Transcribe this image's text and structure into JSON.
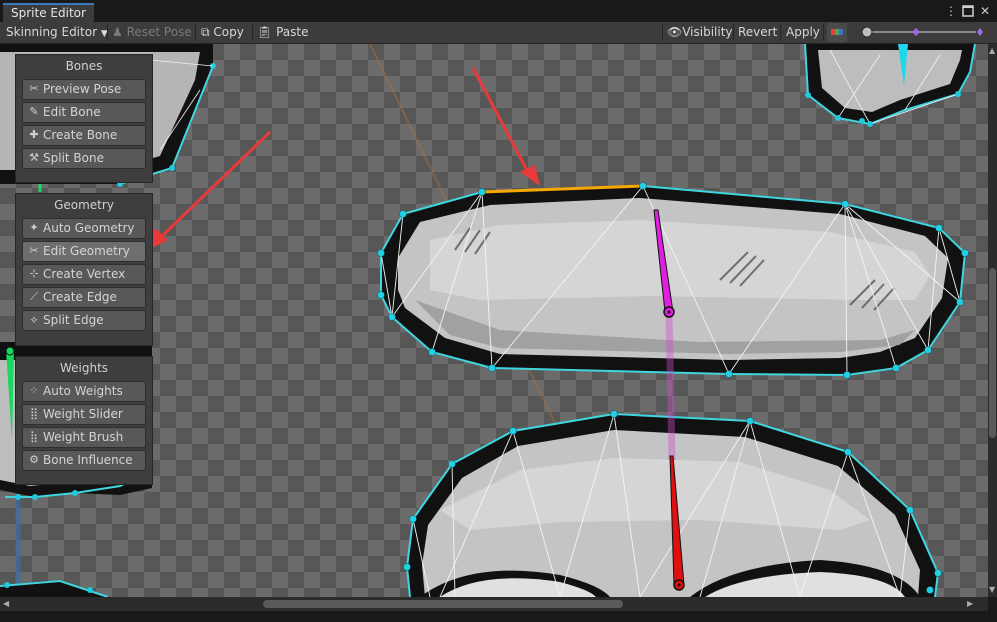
{
  "window": {
    "tab_title": "Sprite Editor",
    "menu_icon": "kebab-icon",
    "maximize_icon": "maximize-icon",
    "close_icon": "close-icon"
  },
  "toolbar": {
    "mode_dropdown": "Skinning Editor",
    "reset_pose": "Reset Pose",
    "copy": "Copy",
    "paste": "Paste",
    "visibility": "Visibility",
    "revert": "Revert",
    "apply": "Apply",
    "colors": {
      "accent": "#3a79bb",
      "toolbar_bg": "#3c3c3c"
    }
  },
  "panels": {
    "bones": {
      "title": "Bones",
      "buttons": [
        {
          "label": "Preview Pose",
          "icon": "preview-pose-icon"
        },
        {
          "label": "Edit Bone",
          "icon": "edit-bone-icon"
        },
        {
          "label": "Create Bone",
          "icon": "create-bone-icon"
        },
        {
          "label": "Split Bone",
          "icon": "split-bone-icon"
        }
      ]
    },
    "geometry": {
      "title": "Geometry",
      "buttons": [
        {
          "label": "Auto Geometry",
          "icon": "auto-geometry-icon"
        },
        {
          "label": "Edit Geometry",
          "icon": "edit-geometry-icon",
          "active": true
        },
        {
          "label": "Create Vertex",
          "icon": "create-vertex-icon"
        },
        {
          "label": "Create Edge",
          "icon": "create-edge-icon"
        },
        {
          "label": "Split Edge",
          "icon": "split-edge-icon"
        }
      ]
    },
    "weights": {
      "title": "Weights",
      "buttons": [
        {
          "label": "Auto Weights",
          "icon": "auto-weights-icon"
        },
        {
          "label": "Weight Slider",
          "icon": "weight-slider-icon"
        },
        {
          "label": "Weight Brush",
          "icon": "weight-brush-icon"
        },
        {
          "label": "Bone Influence",
          "icon": "bone-influence-icon"
        }
      ]
    }
  },
  "canvas_colors": {
    "outline": "#3fd6e0",
    "vertex": "#2fd3e6",
    "selected_edge": "#f5a800",
    "bone_magenta": "#e21ee0",
    "bone_red": "#e01010",
    "annotation_arrow": "#e83a3a"
  }
}
